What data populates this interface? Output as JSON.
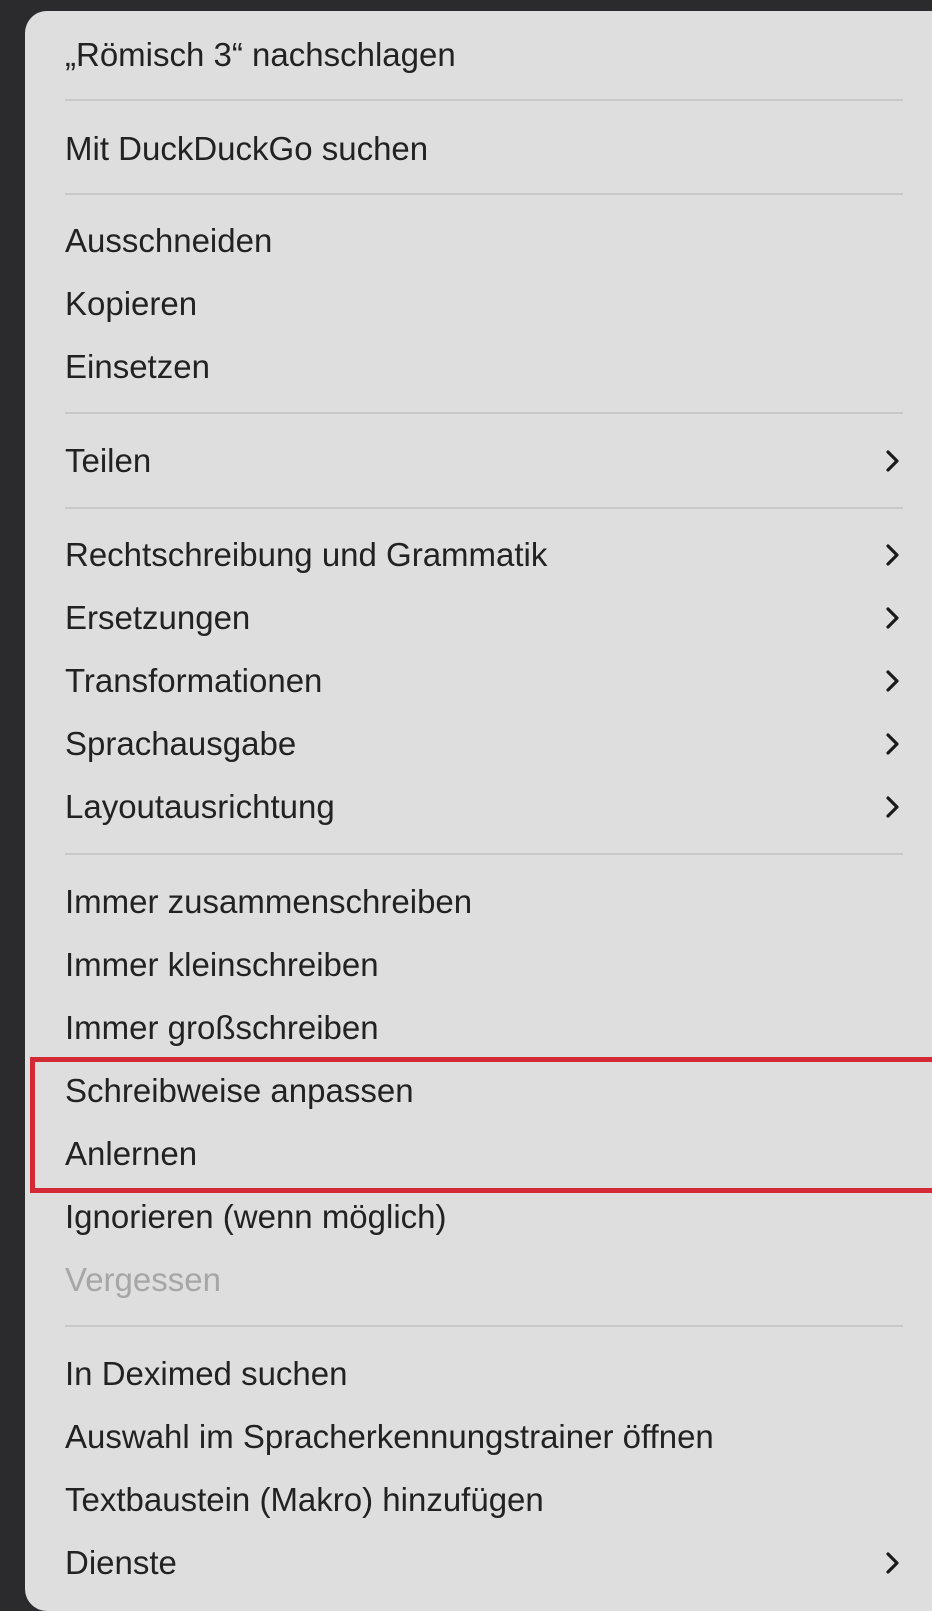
{
  "menu": {
    "groups": [
      {
        "items": [
          {
            "label": "„Römisch 3“ nachschlagen"
          }
        ]
      },
      {
        "items": [
          {
            "label": "Mit DuckDuckGo suchen"
          }
        ]
      },
      {
        "items": [
          {
            "label": "Ausschneiden"
          },
          {
            "label": "Kopieren"
          },
          {
            "label": "Einsetzen"
          }
        ]
      },
      {
        "items": [
          {
            "label": "Teilen",
            "submenu": true
          }
        ]
      },
      {
        "items": [
          {
            "label": "Rechtschreibung und Grammatik",
            "submenu": true
          },
          {
            "label": "Ersetzungen",
            "submenu": true
          },
          {
            "label": "Transformationen",
            "submenu": true
          },
          {
            "label": "Sprachausgabe",
            "submenu": true
          },
          {
            "label": "Layoutausrichtung",
            "submenu": true
          }
        ]
      },
      {
        "items": [
          {
            "label": "Immer zusammenschreiben"
          },
          {
            "label": "Immer kleinschreiben"
          },
          {
            "label": "Immer großschreiben"
          },
          {
            "label": "Schreibweise anpassen"
          },
          {
            "label": "Anlernen"
          },
          {
            "label": "Ignorieren (wenn möglich)"
          },
          {
            "label": "Vergessen",
            "disabled": true
          }
        ]
      },
      {
        "items": [
          {
            "label": "In Deximed suchen"
          },
          {
            "label": "Auswahl im Spracherkennungstrainer öffnen"
          },
          {
            "label": "Textbaustein (Makro) hinzufügen"
          },
          {
            "label": "Dienste",
            "submenu": true
          }
        ]
      }
    ]
  },
  "colors": {
    "menu_background": "#dedede",
    "text": "#222222",
    "disabled_text": "#a6a6a6",
    "separator": "#c8c8c8",
    "highlight_border": "#d42a35"
  },
  "icons": {
    "submenu": "chevron-right-icon"
  }
}
